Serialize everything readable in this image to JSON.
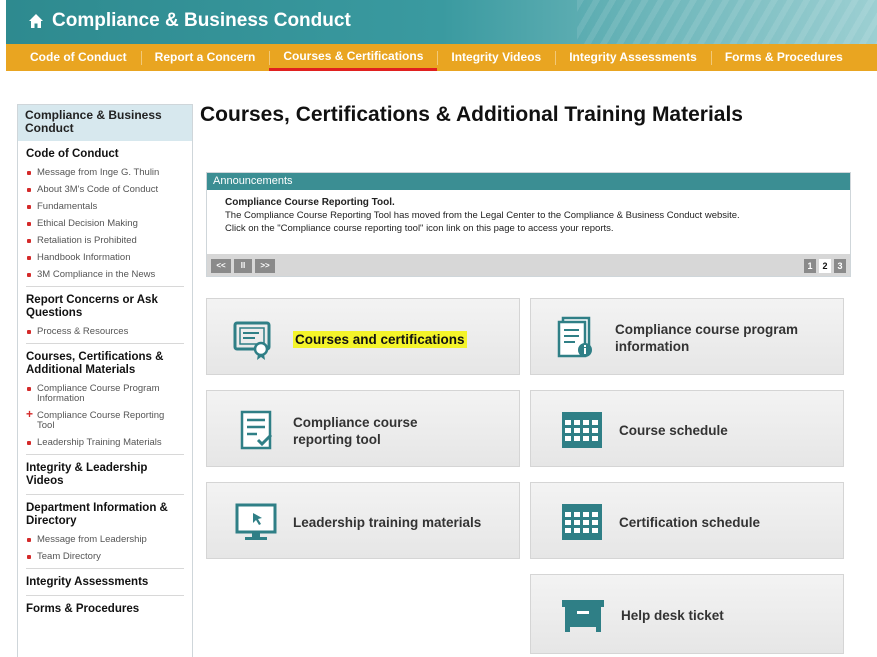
{
  "header": {
    "title": "Compliance & Business Conduct"
  },
  "nav": [
    {
      "label": "Code of Conduct"
    },
    {
      "label": "Report a Concern"
    },
    {
      "label": "Courses & Certifications"
    },
    {
      "label": "Integrity Videos"
    },
    {
      "label": "Integrity Assessments"
    },
    {
      "label": "Forms & Procedures"
    }
  ],
  "sidebar": {
    "heading": "Compliance & Business Conduct",
    "sections": [
      {
        "title": "Code of Conduct",
        "items": [
          "Message from Inge G. Thulin",
          "About 3M's Code of Conduct",
          "Fundamentals",
          "Ethical Decision Making",
          "Retaliation is Prohibited",
          "Handbook Information",
          "3M Compliance in the News"
        ]
      },
      {
        "title": "Report Concerns or Ask Questions",
        "items": [
          "Process & Resources"
        ]
      },
      {
        "title": "Courses, Certifications & Additional Materials",
        "items": [
          "Compliance Course Program Information",
          "Compliance Course Reporting Tool",
          "Leadership Training Materials"
        ]
      },
      {
        "title": "Integrity & Leadership Videos",
        "items": []
      },
      {
        "title": "Department Information & Directory",
        "items": [
          "Message from Leadership",
          "Team Directory"
        ]
      },
      {
        "title": "Integrity Assessments",
        "items": []
      },
      {
        "title": "Forms & Procedures",
        "items": []
      }
    ]
  },
  "main": {
    "title": "Courses, Certifications & Additional Training Materials",
    "announcements": {
      "heading": "Announcements",
      "headline": "Compliance Course Reporting Tool.",
      "line1": "The Compliance Course Reporting Tool has moved from the Legal Center to the Compliance & Business Conduct website.",
      "line2": "Click on the \"Compliance course reporting tool\" icon link on this page to access your reports.",
      "controls": {
        "prev": "<<",
        "pause": "II",
        "next": ">>"
      },
      "pages": [
        "1",
        "2",
        "3"
      ],
      "current_page": "2"
    },
    "tiles": {
      "courses": "Courses and certifications",
      "program_line1": "Compliance course program",
      "program_line2": "information",
      "reporting_line1": "Compliance course",
      "reporting_line2": "reporting tool",
      "schedule": "Course schedule",
      "leadership": "Leadership training materials",
      "certification": "Certification  schedule",
      "helpdesk": "Help desk ticket"
    }
  },
  "colors": {
    "teal": "#3b8e93",
    "orange": "#e9a521",
    "accent_red": "#e0201f",
    "highlight": "#f4f42a"
  }
}
